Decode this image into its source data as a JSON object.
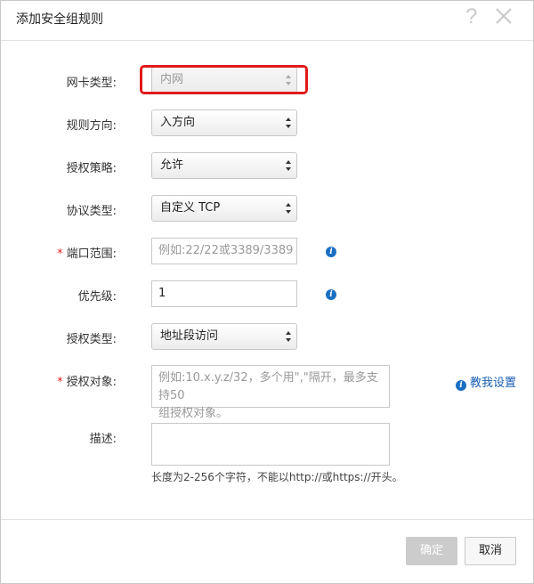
{
  "dialog": {
    "title": "添加安全组规则",
    "help_icon": "?",
    "close_icon": "close-icon"
  },
  "form": {
    "nic_type": {
      "label": "网卡类型:",
      "value": "内网",
      "disabled": true
    },
    "direction": {
      "label": "规则方向:",
      "value": "入方向"
    },
    "policy": {
      "label": "授权策略:",
      "value": "允许"
    },
    "protocol": {
      "label": "协议类型:",
      "value": "自定义 TCP"
    },
    "port_range": {
      "required_mark": "*",
      "label": "端口范围:",
      "placeholder": "例如:22/22或3389/3389"
    },
    "priority": {
      "label": "优先级:",
      "value": "1"
    },
    "auth_type": {
      "label": "授权类型:",
      "value": "地址段访问"
    },
    "auth_object": {
      "required_mark": "*",
      "label": "授权对象:",
      "placeholder_line1": "例如:10.x.y.z/32，多个用\",\"隔开，最多支持50",
      "placeholder_line2": "组授权对象。"
    },
    "tutorial_link": "教我设置",
    "description": {
      "label": "描述:",
      "value": "",
      "hint": "长度为2-256个字符，不能以http://或https://开头。"
    }
  },
  "buttons": {
    "ok": "确定",
    "cancel": "取消"
  },
  "colors": {
    "highlight": "#e01b1b",
    "link": "#1a5fb4",
    "info_icon": "#1a6fc2",
    "disabled_button": "#cccccc"
  }
}
